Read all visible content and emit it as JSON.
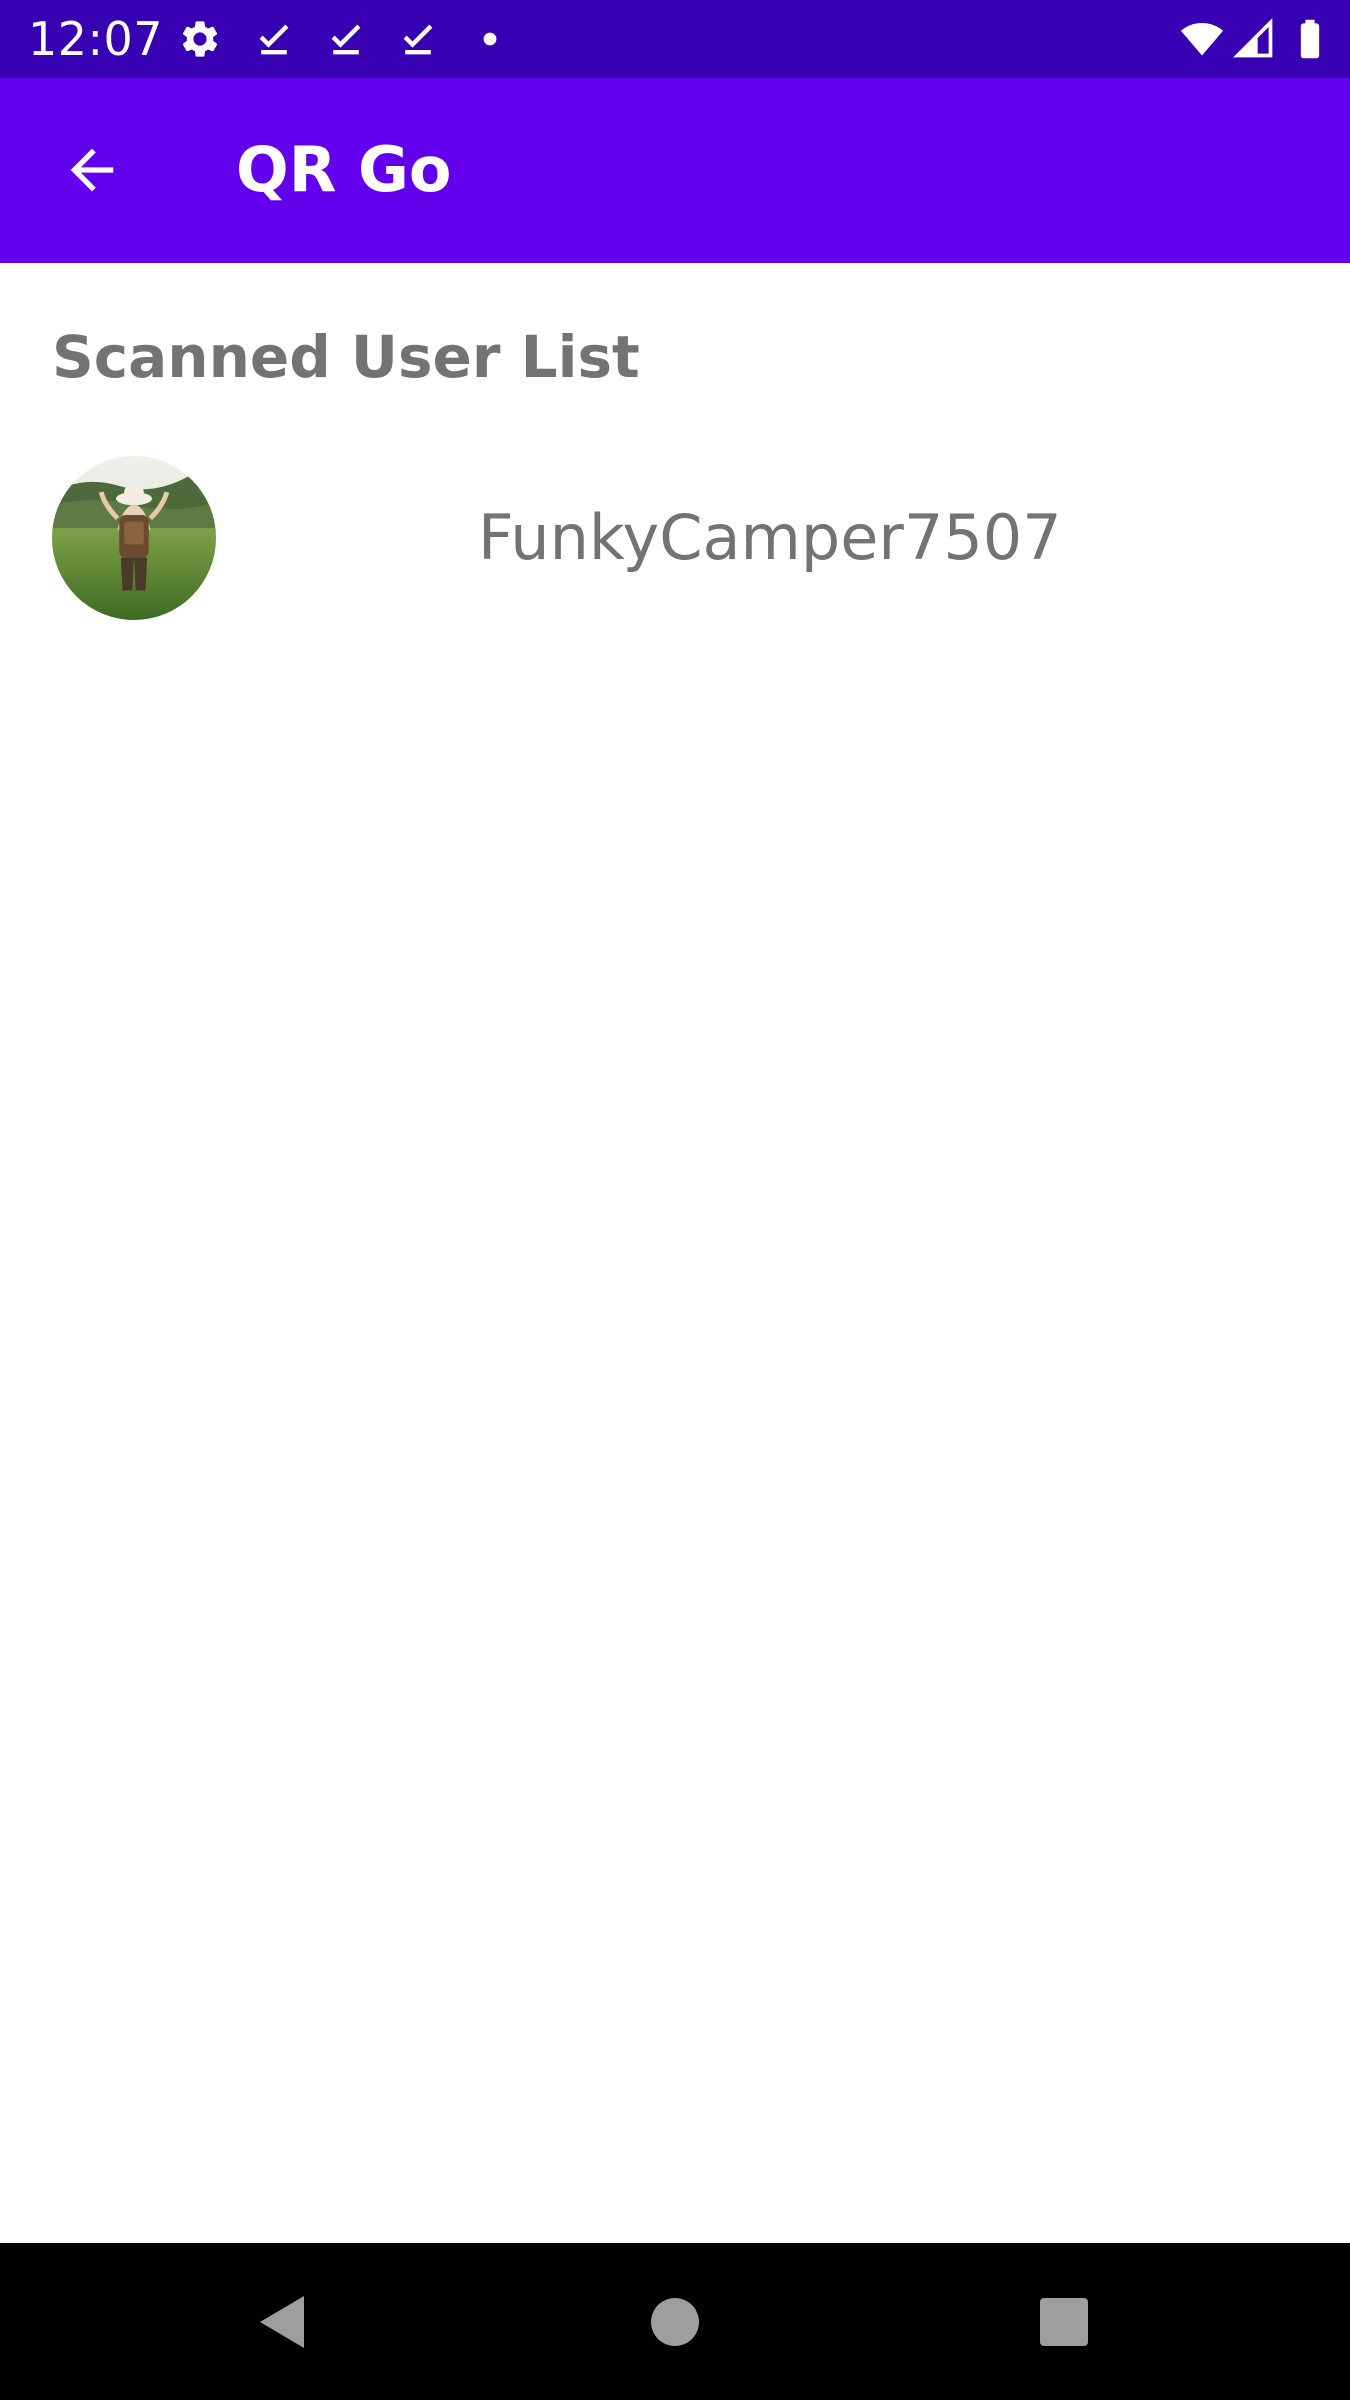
{
  "status_bar": {
    "time": "12:07",
    "icons": [
      "gear-icon",
      "download-done-icon",
      "download-done-icon",
      "download-done-icon",
      "dot-icon",
      "wifi-icon",
      "signal-icon",
      "battery-icon"
    ]
  },
  "app_bar": {
    "title": "QR Go",
    "back_icon": "arrow-back-icon"
  },
  "main": {
    "heading": "Scanned User List",
    "users": [
      {
        "username": "FunkyCamper7507",
        "avatar": "user-avatar-photo"
      }
    ]
  },
  "nav_bar": {
    "buttons": [
      "back-triangle-icon",
      "home-circle-icon",
      "recents-square-icon"
    ]
  },
  "colors": {
    "status_bar": "#3700b3",
    "app_bar": "#6200ee",
    "text_secondary": "#737373",
    "nav_bar": "#000000"
  }
}
